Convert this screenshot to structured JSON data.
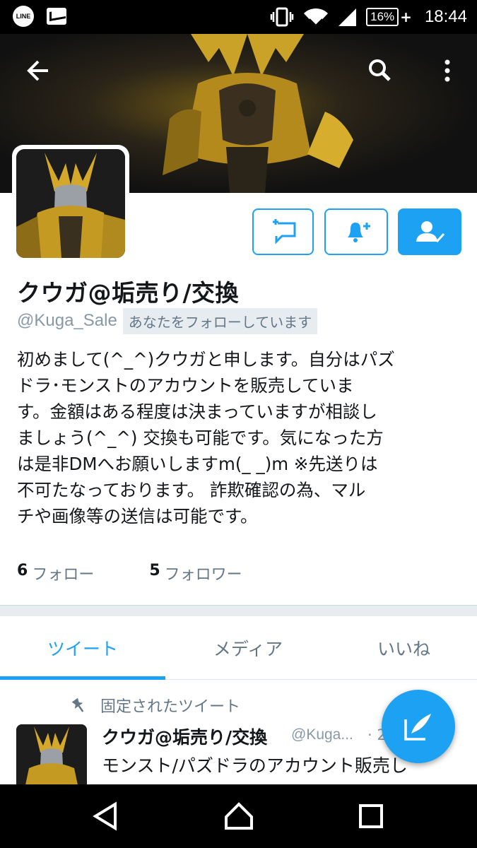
{
  "status_bar": {
    "line_label": "LINE",
    "battery": "16%",
    "time": "18:44"
  },
  "profile": {
    "name": "クウガ@垢売り/交換",
    "handle": "@Kuga_Sale",
    "follows_you": "あなたをフォローしています",
    "bio_lines": [
      "初めまして(^_^)クウガと申します。自分はパズ",
      "ドラ･モンストのアカウントを販売していま",
      "す。金額はある程度は決まっていますが相談し",
      "ましょう(^_^) 交換も可能です。気になった方",
      "は是非DMへお願いしますm(_ _)m ※先送りは",
      "不可たなっております。 詐欺確認の為、マル",
      "チや画像等の送信は可能です。"
    ],
    "following_count": "6",
    "following_label": "フォロー",
    "followers_count": "5",
    "followers_label": "フォロワー"
  },
  "tabs": [
    {
      "label": "ツイート",
      "active": true
    },
    {
      "label": "メディア",
      "active": false
    },
    {
      "label": "いいね",
      "active": false
    }
  ],
  "pinned_tweet": {
    "pinned_label": "固定されたツイート",
    "name": "クウガ@垢売り/交換",
    "handle": "@Kuga...",
    "time": "· 2",
    "text": "モンスト/パズドラのアカウント販売し"
  },
  "colors": {
    "accent": "#1da1f2",
    "secondary_text": "#657786",
    "divider": "#e6ecf0"
  },
  "icons": [
    "back-arrow-icon",
    "search-icon",
    "more-vert-icon",
    "direct-message-icon",
    "notification-bell-icon",
    "following-user-icon",
    "pin-icon",
    "compose-tweet-icon",
    "nav-back-icon",
    "nav-home-icon",
    "nav-recents-icon"
  ]
}
